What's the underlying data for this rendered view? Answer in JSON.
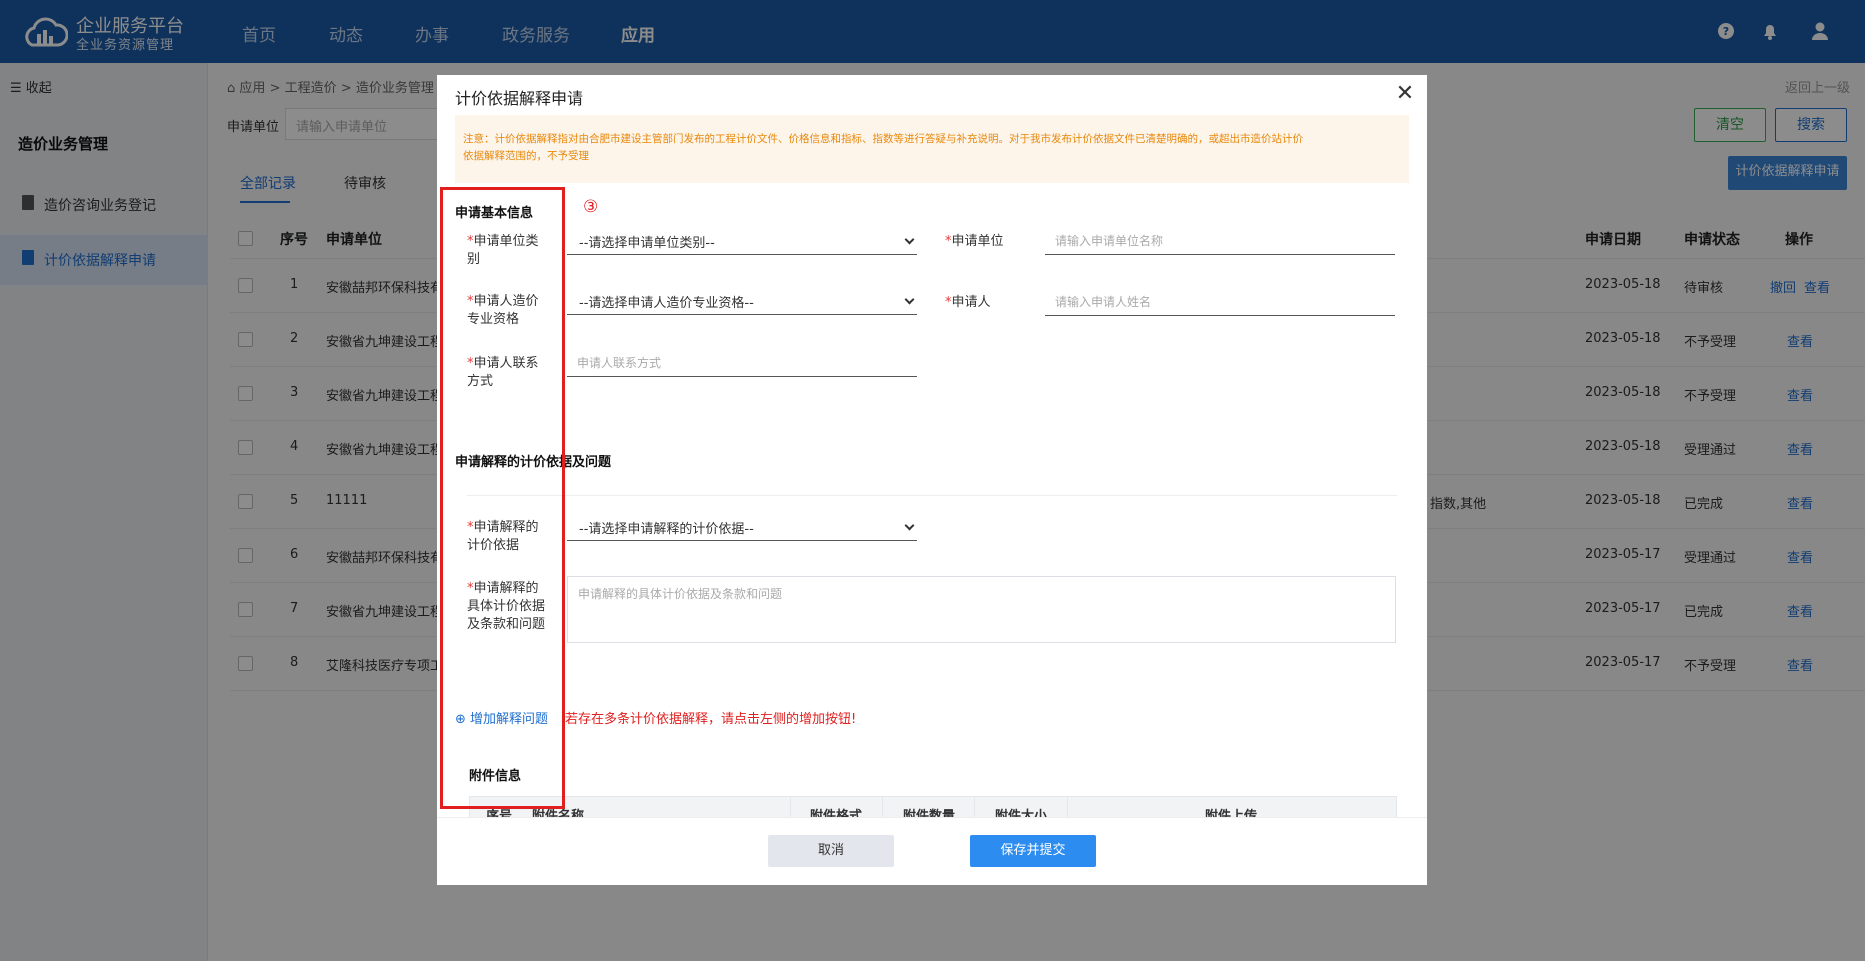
{
  "header": {
    "brand_title": "企业服务平台",
    "brand_subtitle": "全业务资源管理",
    "nav": [
      "首页",
      "动态",
      "办事",
      "政务服务",
      "应用"
    ],
    "active_nav": "应用"
  },
  "sidebar": {
    "collapse_label": "收起",
    "section_title": "造价业务管理",
    "items": [
      {
        "label": "造价咨询业务登记"
      },
      {
        "label": "计价依据解释申请"
      }
    ]
  },
  "breadcrumb": {
    "home": "应用",
    "sep1": ">",
    "level2": "工程造价",
    "sep2": ">",
    "level3": "造价业务管理"
  },
  "back_link": "返回上一级",
  "filter": {
    "label": "申请单位",
    "placeholder": "请输入申请单位",
    "clear_label": "清空",
    "search_label": "搜索"
  },
  "apply_button": "计价依据解释申请",
  "tabs": [
    "全部记录",
    "待审核"
  ],
  "table": {
    "headers": {
      "no": "序号",
      "unit": "申请单位",
      "date": "申请日期",
      "status": "申请状态",
      "ops": "操作"
    },
    "rows": [
      {
        "no": "1",
        "unit": "安徽喆邦环保科技有",
        "extra": "",
        "date": "2023-05-18",
        "status": "待审核",
        "ops": [
          "撤回",
          "查看"
        ]
      },
      {
        "no": "2",
        "unit": "安徽省九坤建设工程",
        "extra": "",
        "date": "2023-05-18",
        "status": "不予受理",
        "ops": [
          "查看"
        ]
      },
      {
        "no": "3",
        "unit": "安徽省九坤建设工程",
        "extra": "",
        "date": "2023-05-18",
        "status": "不予受理",
        "ops": [
          "查看"
        ]
      },
      {
        "no": "4",
        "unit": "安徽省九坤建设工程",
        "extra": "",
        "date": "2023-05-18",
        "status": "受理通过",
        "ops": [
          "查看"
        ]
      },
      {
        "no": "5",
        "unit": "11111",
        "extra": "指数,其他",
        "date": "2023-05-18",
        "status": "已完成",
        "ops": [
          "查看"
        ]
      },
      {
        "no": "6",
        "unit": "安徽喆邦环保科技有",
        "extra": "",
        "date": "2023-05-17",
        "status": "受理通过",
        "ops": [
          "查看"
        ]
      },
      {
        "no": "7",
        "unit": "安徽省九坤建设工程",
        "extra": "",
        "date": "2023-05-17",
        "status": "已完成",
        "ops": [
          "查看"
        ]
      },
      {
        "no": "8",
        "unit": "艾隆科技医疗专项工",
        "extra": "",
        "date": "2023-05-17",
        "status": "不予受理",
        "ops": [
          "查看"
        ]
      }
    ]
  },
  "modal": {
    "title": "计价依据解释申请",
    "notice_line1": "注意：计价依据解释指对由合肥市建设主管部门发布的工程计价文件、价格信息和指标、指数等进行答疑与补充说明。对于我市发布计价依据文件已清楚明确的，或超出市造价站计价",
    "notice_line2": "依据解释范围的，不予受理",
    "annotation": "③",
    "section_basic": "申请基本信息",
    "req_mark": "*",
    "fields": {
      "unit_type": {
        "label": "申请单位类别",
        "value": "--请选择申请单位类别--"
      },
      "unit": {
        "label": "申请单位",
        "placeholder": "请输入申请单位名称"
      },
      "qualification": {
        "label": "申请人造价专业资格",
        "value": "--请选择申请人造价专业资格--"
      },
      "applicant": {
        "label": "申请人",
        "placeholder": "请输入申请人姓名"
      },
      "contact": {
        "label": "申请人联系方式",
        "placeholder": "申请人联系方式"
      },
      "basis": {
        "label": "申请解释的计价依据",
        "value": "--请选择申请解释的计价依据--"
      },
      "detail": {
        "label": "申请解释的具体计价依据及条款和问题",
        "placeholder": "申请解释的具体计价依据及条款和问题"
      }
    },
    "section_questions": "申请解释的计价依据及问题",
    "add_question": "增加解释问题",
    "add_hint": "若存在多条计价依据解释，请点击左侧的增加按钮!",
    "section_attach": "附件信息",
    "attach_headers": [
      "序号",
      "附件名称",
      "附件格式",
      "附件数量",
      "附件大小",
      "附件上传"
    ],
    "cancel": "取消",
    "submit": "保存并提交"
  },
  "colors": {
    "header": "#1a5ca8",
    "link": "#1f6fd0",
    "primary": "#2d8cf0",
    "annotation": "#e11f1f",
    "notice": "#e8890c"
  }
}
